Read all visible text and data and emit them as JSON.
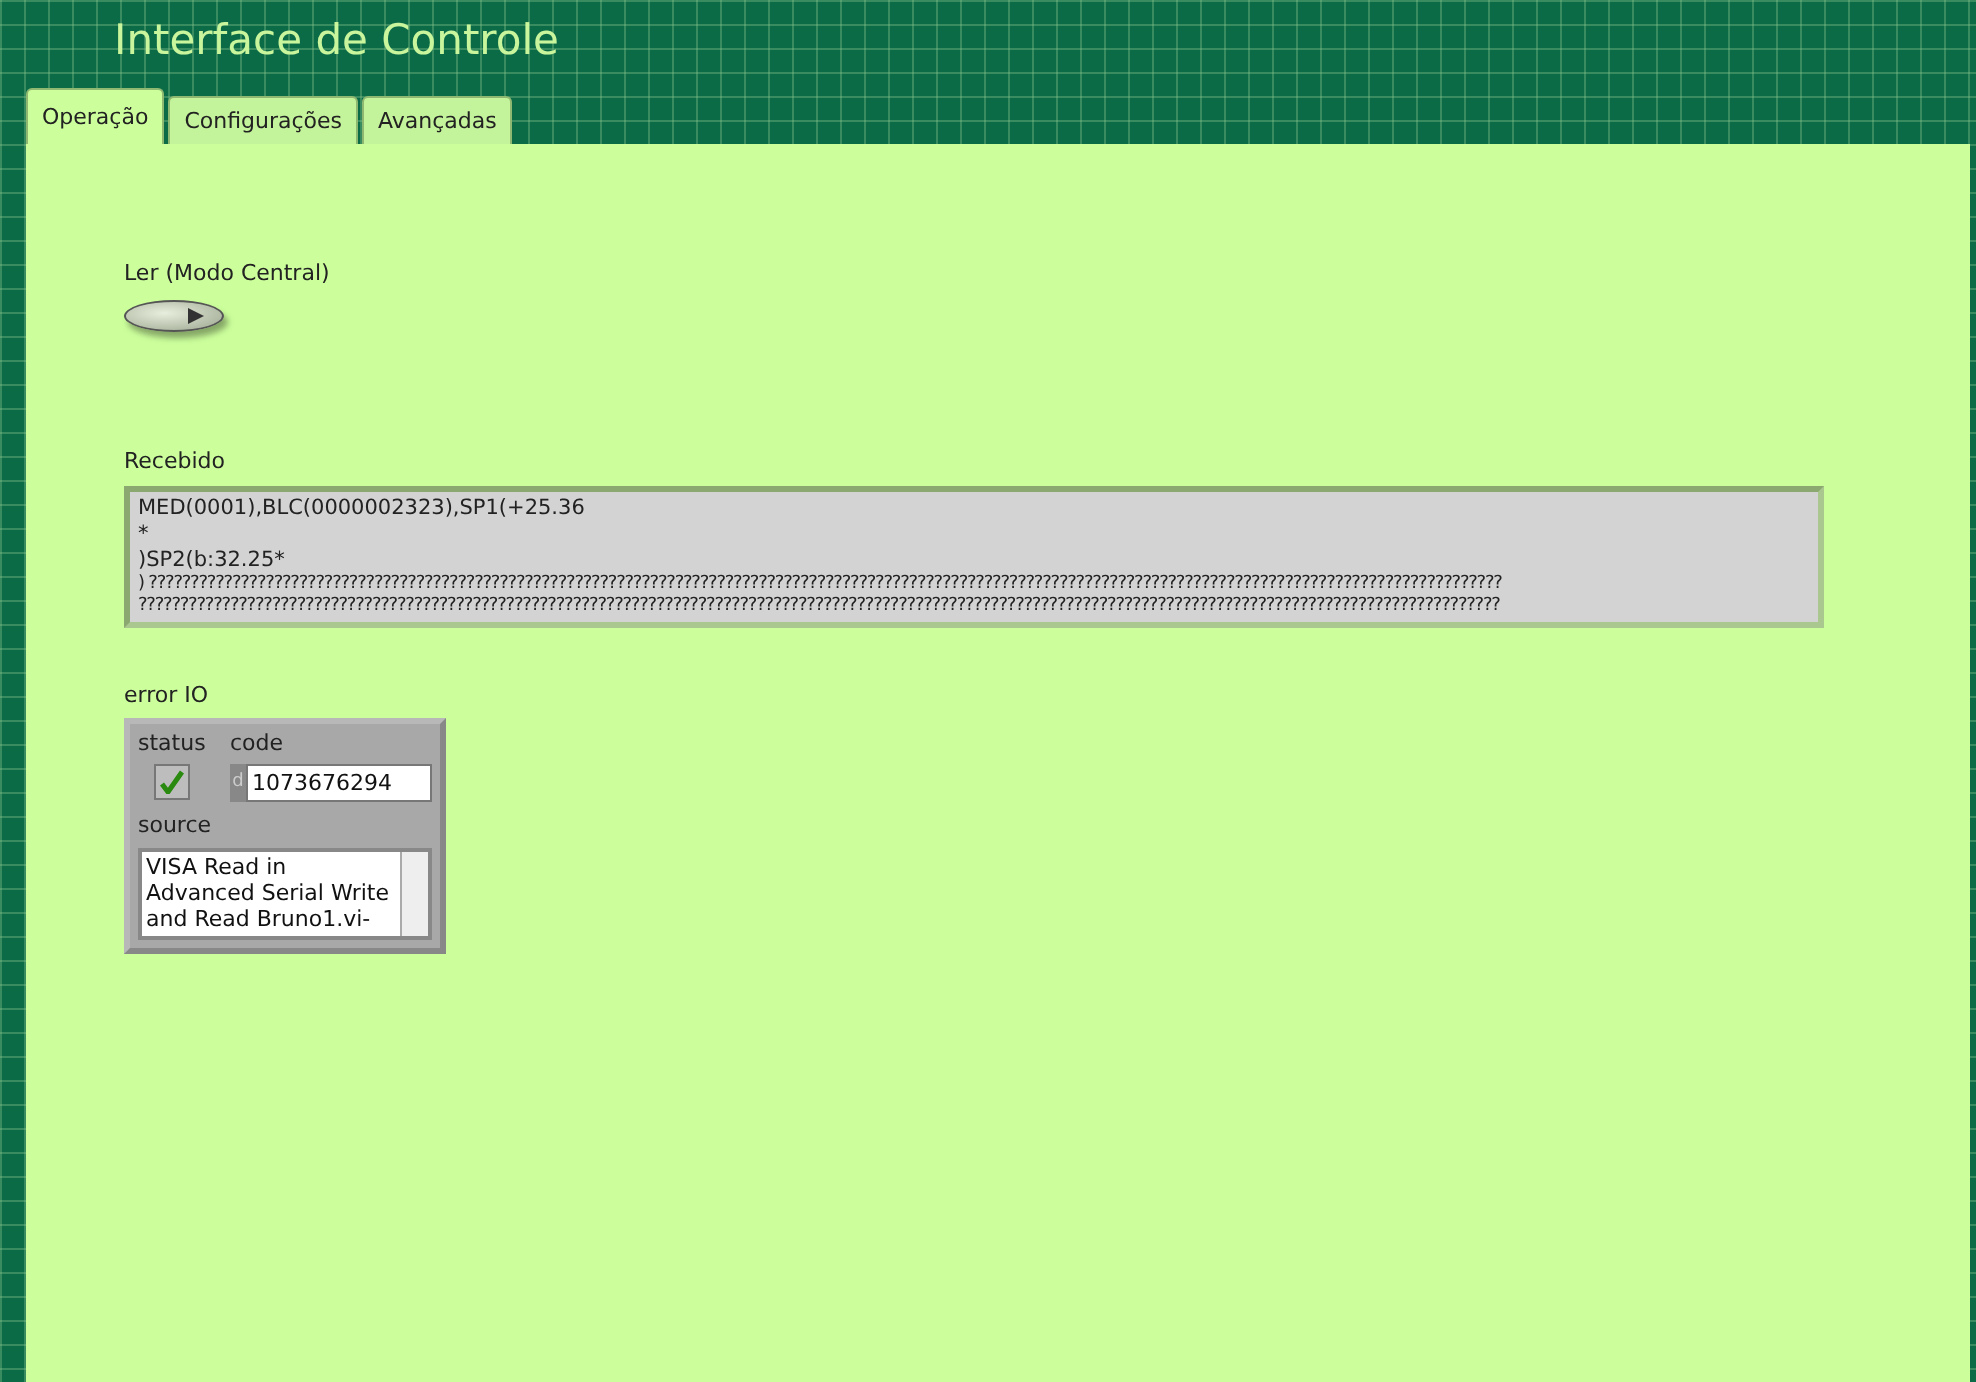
{
  "window": {
    "title": "Interface de Controle"
  },
  "tabs": [
    {
      "label": "Operação",
      "selected": true
    },
    {
      "label": "Configurações",
      "selected": false
    },
    {
      "label": "Avançadas",
      "selected": false
    }
  ],
  "read_button": {
    "label": "Ler (Modo Central)",
    "on": false
  },
  "received": {
    "label": "Recebido",
    "lines": [
      "MED(0001),BLC(0000002323),SP1(+25.36",
      "*",
      ")SP2(b:32.25*",
      ") ??????????????????????????????????????????????????????????????????????????????????????????????????????????????????????????????????????????????????????????????????",
      "???????????????????????????????????????????????????????????????????????????????????????????????????????????????????????????????????????????????????????????????????"
    ]
  },
  "error_io": {
    "label": "error IO",
    "status_label": "status",
    "status": {
      "checked": true
    },
    "code_label": "code",
    "radix": "d",
    "code": "1073676294",
    "source_label": "source",
    "source": "VISA Read in Advanced Serial Write and Read Bruno1.vi-"
  }
}
